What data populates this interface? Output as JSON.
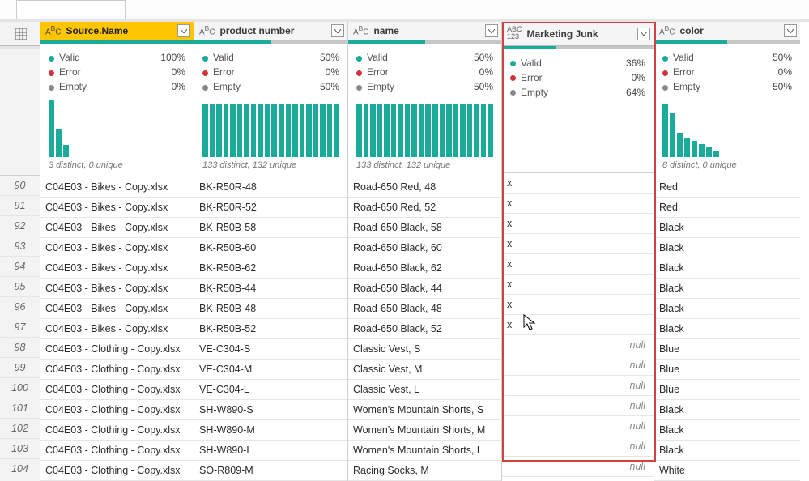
{
  "tabstrip": {
    "active_tab": ""
  },
  "columns": [
    {
      "key": "source_name",
      "type": "ABC",
      "label": "Source.Name",
      "selected": true,
      "quality": {
        "valid": 100,
        "error": 0,
        "empty": 0
      },
      "stats": {
        "valid": "100%",
        "error": "0%",
        "empty": "0%"
      },
      "hist": [
        70,
        35,
        15
      ],
      "dist_caption": "3 distinct, 0 unique"
    },
    {
      "key": "product_number",
      "type": "ABC",
      "label": "product number",
      "selected": false,
      "quality": {
        "valid": 50,
        "error": 0,
        "empty": 50
      },
      "stats": {
        "valid": "50%",
        "error": "0%",
        "empty": "50%"
      },
      "hist": [
        66,
        66,
        66,
        66,
        66,
        66,
        66,
        66,
        66,
        66,
        66,
        66,
        66,
        66,
        66,
        66,
        66,
        66,
        66,
        66
      ],
      "dist_caption": "133 distinct, 132 unique"
    },
    {
      "key": "name",
      "type": "ABC",
      "label": "name",
      "selected": false,
      "quality": {
        "valid": 50,
        "error": 0,
        "empty": 50
      },
      "stats": {
        "valid": "50%",
        "error": "0%",
        "empty": "50%"
      },
      "hist": [
        66,
        66,
        66,
        66,
        66,
        66,
        66,
        66,
        66,
        66,
        66,
        66,
        66,
        66,
        66,
        66,
        66,
        66,
        66,
        66
      ],
      "dist_caption": "133 distinct, 132 unique"
    },
    {
      "key": "marketing_junk",
      "type": "ABC123",
      "label": "Marketing Junk",
      "selected": false,
      "quality": {
        "valid": 36,
        "error": 0,
        "empty": 64
      },
      "stats": {
        "valid": "36%",
        "error": "0%",
        "empty": "64%"
      },
      "hist": [],
      "dist_caption": ""
    },
    {
      "key": "color",
      "type": "ABC",
      "label": "color",
      "selected": false,
      "quality": {
        "valid": 50,
        "error": 0,
        "empty": 50
      },
      "stats": {
        "valid": "50%",
        "error": "0%",
        "empty": "50%"
      },
      "hist": [
        66,
        55,
        30,
        24,
        20,
        16,
        12,
        8
      ],
      "dist_caption": "8 distinct, 0 unique"
    }
  ],
  "stat_labels": {
    "valid": "Valid",
    "error": "Error",
    "empty": "Empty"
  },
  "row_numbers": [
    "90",
    "91",
    "92",
    "93",
    "94",
    "95",
    "96",
    "97",
    "98",
    "99",
    "100",
    "101",
    "102",
    "103",
    "104"
  ],
  "rows": [
    {
      "source_name": "C04E03 - Bikes - Copy.xlsx",
      "product_number": "BK-R50R-48",
      "name": "Road-650 Red, 48",
      "marketing_junk": "x",
      "color": "Red"
    },
    {
      "source_name": "C04E03 - Bikes - Copy.xlsx",
      "product_number": "BK-R50R-52",
      "name": "Road-650 Red, 52",
      "marketing_junk": "x",
      "color": "Red"
    },
    {
      "source_name": "C04E03 - Bikes - Copy.xlsx",
      "product_number": "BK-R50B-58",
      "name": "Road-650 Black, 58",
      "marketing_junk": "x",
      "color": "Black"
    },
    {
      "source_name": "C04E03 - Bikes - Copy.xlsx",
      "product_number": "BK-R50B-60",
      "name": "Road-650 Black, 60",
      "marketing_junk": "x",
      "color": "Black"
    },
    {
      "source_name": "C04E03 - Bikes - Copy.xlsx",
      "product_number": "BK-R50B-62",
      "name": "Road-650 Black, 62",
      "marketing_junk": "x",
      "color": "Black"
    },
    {
      "source_name": "C04E03 - Bikes - Copy.xlsx",
      "product_number": "BK-R50B-44",
      "name": "Road-650 Black, 44",
      "marketing_junk": "x",
      "color": "Black"
    },
    {
      "source_name": "C04E03 - Bikes - Copy.xlsx",
      "product_number": "BK-R50B-48",
      "name": "Road-650 Black, 48",
      "marketing_junk": "x",
      "color": "Black"
    },
    {
      "source_name": "C04E03 - Bikes - Copy.xlsx",
      "product_number": "BK-R50B-52",
      "name": "Road-650 Black, 52",
      "marketing_junk": "x",
      "color": "Black"
    },
    {
      "source_name": "C04E03 - Clothing - Copy.xlsx",
      "product_number": "VE-C304-S",
      "name": "Classic Vest, S",
      "marketing_junk": null,
      "color": "Blue"
    },
    {
      "source_name": "C04E03 - Clothing - Copy.xlsx",
      "product_number": "VE-C304-M",
      "name": "Classic Vest, M",
      "marketing_junk": null,
      "color": "Blue"
    },
    {
      "source_name": "C04E03 - Clothing - Copy.xlsx",
      "product_number": "VE-C304-L",
      "name": "Classic Vest, L",
      "marketing_junk": null,
      "color": "Blue"
    },
    {
      "source_name": "C04E03 - Clothing - Copy.xlsx",
      "product_number": "SH-W890-S",
      "name": "Women's Mountain Shorts, S",
      "marketing_junk": null,
      "color": "Black"
    },
    {
      "source_name": "C04E03 - Clothing - Copy.xlsx",
      "product_number": "SH-W890-M",
      "name": "Women's Mountain Shorts, M",
      "marketing_junk": null,
      "color": "Black"
    },
    {
      "source_name": "C04E03 - Clothing - Copy.xlsx",
      "product_number": "SH-W890-L",
      "name": "Women's Mountain Shorts, L",
      "marketing_junk": null,
      "color": "Black"
    },
    {
      "source_name": "C04E03 - Clothing - Copy.xlsx",
      "product_number": "SO-R809-M",
      "name": "Racing Socks, M",
      "marketing_junk": null,
      "color": "White"
    }
  ],
  "null_text": "null"
}
